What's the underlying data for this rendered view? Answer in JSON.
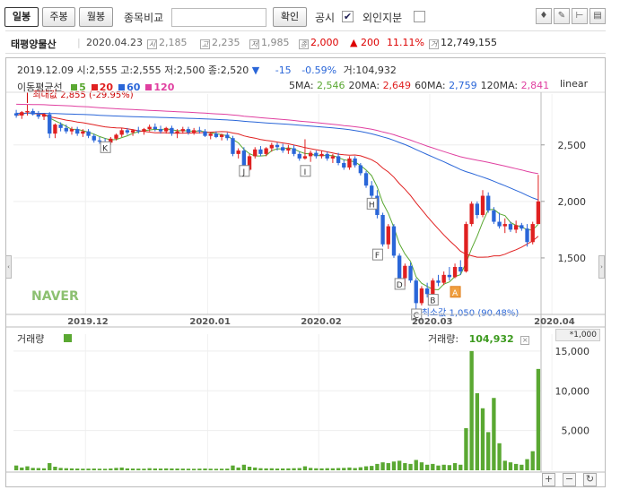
{
  "toolbar": {
    "tab_daily": "일봉",
    "tab_weekly": "주봉",
    "tab_monthly": "월봉",
    "compare_label": "종목비교",
    "compare_input_value": "",
    "confirm_label": "확인",
    "disclosure_label": "공시",
    "disclosure_checked": "✔",
    "foreign_label": "외인지분",
    "foreign_checked": ""
  },
  "info": {
    "name": "태평양물산",
    "date": "2020.04.23",
    "open": "2,185",
    "high": "2,235",
    "low": "1,985",
    "close": "2,000",
    "change": "▲ 200",
    "change_pct": "11.11%",
    "volume": "12,749,155",
    "icon_open": "시",
    "icon_high": "고",
    "icon_low": "저",
    "icon_close": "종",
    "icon_volume": "거"
  },
  "chart": {
    "header_line": "2019.12.09  시:2,555  고:2,555  저:2,500  종:2,520",
    "header_arrow": "▼",
    "header_change": "-15",
    "header_change_pct": "-0.59%",
    "header_volume": "거:104,932",
    "ma_title": "이동평균선",
    "ma_legend": [
      {
        "label": "5",
        "color": "#5aa832"
      },
      {
        "label": "20",
        "color": "#e02020"
      },
      {
        "label": "60",
        "color": "#2a66d8"
      },
      {
        "label": "120",
        "color": "#e040a0"
      }
    ],
    "ma_values": [
      {
        "label": "5MA:",
        "value": "2,546",
        "color": "#5aa832"
      },
      {
        "label": "20MA:",
        "value": "2,649",
        "color": "#e02020"
      },
      {
        "label": "60MA:",
        "value": "2,759",
        "color": "#2a66d8"
      },
      {
        "label": "120MA:",
        "value": "2,841",
        "color": "#e040a0"
      }
    ],
    "scale_label": "linear",
    "max_label": "최대값 2,855 (-29.95%)",
    "min_label": "최소값 1,050 (90.48%)",
    "watermark": "NAVER",
    "price_ticks": [
      "2,500",
      "2,000",
      "1,500"
    ],
    "date_ticks": [
      "2019.12",
      "2020.01",
      "2020.02",
      "2020.03",
      "2020.04"
    ],
    "markers": [
      "K",
      "J",
      "I",
      "H",
      "F",
      "D",
      "C",
      "B",
      "A"
    ],
    "volume_title": "거래량",
    "volume_label": "거래량:",
    "volume_value": "104,932",
    "volume_unit": "*1,000",
    "volume_ticks": [
      "15,000",
      "10,000",
      "5,000"
    ]
  },
  "chart_data": {
    "type": "candlestick",
    "title": "태평양물산",
    "x_ticks": [
      "2019.12",
      "2020.01",
      "2020.02",
      "2020.03",
      "2020.04"
    ],
    "y_ticks": [
      1500,
      2000,
      2500
    ],
    "ylim": [
      1000,
      2950
    ],
    "volume_ylim": [
      0,
      16000
    ],
    "volume_unit": "*1,000",
    "max_price": 2855,
    "min_price": 1050,
    "last_close": 2000,
    "candles": [
      {
        "o": 2780,
        "h": 2810,
        "l": 2740,
        "c": 2760,
        "v": 600
      },
      {
        "o": 2760,
        "h": 2800,
        "l": 2730,
        "c": 2790,
        "v": 350
      },
      {
        "o": 2790,
        "h": 2855,
        "l": 2760,
        "c": 2800,
        "v": 500
      },
      {
        "o": 2800,
        "h": 2820,
        "l": 2760,
        "c": 2770,
        "v": 300
      },
      {
        "o": 2770,
        "h": 2800,
        "l": 2730,
        "c": 2750,
        "v": 280
      },
      {
        "o": 2750,
        "h": 2780,
        "l": 2720,
        "c": 2770,
        "v": 250
      },
      {
        "o": 2770,
        "h": 2790,
        "l": 2560,
        "c": 2600,
        "v": 900
      },
      {
        "o": 2600,
        "h": 2690,
        "l": 2560,
        "c": 2680,
        "v": 450
      },
      {
        "o": 2680,
        "h": 2700,
        "l": 2620,
        "c": 2650,
        "v": 300
      },
      {
        "o": 2650,
        "h": 2680,
        "l": 2600,
        "c": 2620,
        "v": 260
      },
      {
        "o": 2620,
        "h": 2660,
        "l": 2590,
        "c": 2640,
        "v": 240
      },
      {
        "o": 2640,
        "h": 2660,
        "l": 2580,
        "c": 2600,
        "v": 220
      },
      {
        "o": 2600,
        "h": 2640,
        "l": 2570,
        "c": 2620,
        "v": 200
      },
      {
        "o": 2620,
        "h": 2640,
        "l": 2560,
        "c": 2580,
        "v": 210
      },
      {
        "o": 2580,
        "h": 2600,
        "l": 2520,
        "c": 2540,
        "v": 220
      },
      {
        "o": 2540,
        "h": 2570,
        "l": 2510,
        "c": 2530,
        "v": 200
      },
      {
        "o": 2530,
        "h": 2560,
        "l": 2500,
        "c": 2520,
        "v": 190
      },
      {
        "o": 2520,
        "h": 2570,
        "l": 2500,
        "c": 2555,
        "v": 230
      },
      {
        "o": 2555,
        "h": 2600,
        "l": 2540,
        "c": 2590,
        "v": 300
      },
      {
        "o": 2590,
        "h": 2650,
        "l": 2570,
        "c": 2630,
        "v": 350
      },
      {
        "o": 2630,
        "h": 2650,
        "l": 2590,
        "c": 2610,
        "v": 240
      },
      {
        "o": 2610,
        "h": 2640,
        "l": 2580,
        "c": 2630,
        "v": 220
      },
      {
        "o": 2630,
        "h": 2660,
        "l": 2600,
        "c": 2620,
        "v": 210
      },
      {
        "o": 2620,
        "h": 2650,
        "l": 2590,
        "c": 2640,
        "v": 200
      },
      {
        "o": 2640,
        "h": 2680,
        "l": 2620,
        "c": 2660,
        "v": 260
      },
      {
        "o": 2660,
        "h": 2690,
        "l": 2620,
        "c": 2640,
        "v": 230
      },
      {
        "o": 2640,
        "h": 2670,
        "l": 2600,
        "c": 2620,
        "v": 220
      },
      {
        "o": 2620,
        "h": 2660,
        "l": 2600,
        "c": 2650,
        "v": 240
      },
      {
        "o": 2650,
        "h": 2670,
        "l": 2580,
        "c": 2600,
        "v": 230
      },
      {
        "o": 2600,
        "h": 2640,
        "l": 2560,
        "c": 2620,
        "v": 220
      },
      {
        "o": 2620,
        "h": 2660,
        "l": 2600,
        "c": 2640,
        "v": 210
      },
      {
        "o": 2640,
        "h": 2660,
        "l": 2590,
        "c": 2610,
        "v": 200
      },
      {
        "o": 2610,
        "h": 2650,
        "l": 2590,
        "c": 2630,
        "v": 190
      },
      {
        "o": 2630,
        "h": 2660,
        "l": 2600,
        "c": 2620,
        "v": 210
      },
      {
        "o": 2620,
        "h": 2640,
        "l": 2570,
        "c": 2580,
        "v": 220
      },
      {
        "o": 2580,
        "h": 2610,
        "l": 2550,
        "c": 2600,
        "v": 200
      },
      {
        "o": 2600,
        "h": 2620,
        "l": 2560,
        "c": 2570,
        "v": 190
      },
      {
        "o": 2570,
        "h": 2600,
        "l": 2540,
        "c": 2590,
        "v": 200
      },
      {
        "o": 2590,
        "h": 2610,
        "l": 2540,
        "c": 2560,
        "v": 210
      },
      {
        "o": 2560,
        "h": 2580,
        "l": 2400,
        "c": 2420,
        "v": 600
      },
      {
        "o": 2420,
        "h": 2470,
        "l": 2380,
        "c": 2450,
        "v": 350
      },
      {
        "o": 2450,
        "h": 2480,
        "l": 2260,
        "c": 2280,
        "v": 700
      },
      {
        "o": 2280,
        "h": 2420,
        "l": 2270,
        "c": 2400,
        "v": 450
      },
      {
        "o": 2400,
        "h": 2480,
        "l": 2380,
        "c": 2460,
        "v": 350
      },
      {
        "o": 2460,
        "h": 2490,
        "l": 2400,
        "c": 2420,
        "v": 260
      },
      {
        "o": 2420,
        "h": 2480,
        "l": 2400,
        "c": 2470,
        "v": 240
      },
      {
        "o": 2470,
        "h": 2520,
        "l": 2440,
        "c": 2500,
        "v": 250
      },
      {
        "o": 2500,
        "h": 2520,
        "l": 2450,
        "c": 2480,
        "v": 220
      },
      {
        "o": 2480,
        "h": 2510,
        "l": 2430,
        "c": 2450,
        "v": 230
      },
      {
        "o": 2450,
        "h": 2500,
        "l": 2420,
        "c": 2470,
        "v": 240
      },
      {
        "o": 2470,
        "h": 2500,
        "l": 2400,
        "c": 2420,
        "v": 260
      },
      {
        "o": 2420,
        "h": 2440,
        "l": 2360,
        "c": 2380,
        "v": 280
      },
      {
        "o": 2380,
        "h": 2550,
        "l": 2370,
        "c": 2400,
        "v": 500
      },
      {
        "o": 2400,
        "h": 2450,
        "l": 2350,
        "c": 2430,
        "v": 300
      },
      {
        "o": 2430,
        "h": 2450,
        "l": 2380,
        "c": 2400,
        "v": 250
      },
      {
        "o": 2400,
        "h": 2450,
        "l": 2380,
        "c": 2420,
        "v": 240
      },
      {
        "o": 2420,
        "h": 2440,
        "l": 2360,
        "c": 2380,
        "v": 260
      },
      {
        "o": 2380,
        "h": 2420,
        "l": 2340,
        "c": 2400,
        "v": 250
      },
      {
        "o": 2400,
        "h": 2430,
        "l": 2320,
        "c": 2340,
        "v": 280
      },
      {
        "o": 2340,
        "h": 2370,
        "l": 2280,
        "c": 2300,
        "v": 300
      },
      {
        "o": 2300,
        "h": 2400,
        "l": 2280,
        "c": 2380,
        "v": 350
      },
      {
        "o": 2380,
        "h": 2400,
        "l": 2300,
        "c": 2320,
        "v": 280
      },
      {
        "o": 2320,
        "h": 2340,
        "l": 2230,
        "c": 2250,
        "v": 380
      },
      {
        "o": 2250,
        "h": 2270,
        "l": 2120,
        "c": 2140,
        "v": 500
      },
      {
        "o": 2140,
        "h": 2180,
        "l": 2030,
        "c": 2050,
        "v": 550
      },
      {
        "o": 2050,
        "h": 2100,
        "l": 1850,
        "c": 1880,
        "v": 800
      },
      {
        "o": 1880,
        "h": 1900,
        "l": 1600,
        "c": 1620,
        "v": 1000
      },
      {
        "o": 1620,
        "h": 1800,
        "l": 1580,
        "c": 1780,
        "v": 900
      },
      {
        "o": 1780,
        "h": 1800,
        "l": 1500,
        "c": 1520,
        "v": 1100
      },
      {
        "o": 1520,
        "h": 1540,
        "l": 1300,
        "c": 1320,
        "v": 1200
      },
      {
        "o": 1320,
        "h": 1450,
        "l": 1250,
        "c": 1430,
        "v": 900
      },
      {
        "o": 1430,
        "h": 1460,
        "l": 1280,
        "c": 1300,
        "v": 800
      },
      {
        "o": 1300,
        "h": 1320,
        "l": 1050,
        "c": 1100,
        "v": 1300
      },
      {
        "o": 1100,
        "h": 1250,
        "l": 1080,
        "c": 1230,
        "v": 1000
      },
      {
        "o": 1230,
        "h": 1280,
        "l": 1150,
        "c": 1180,
        "v": 700
      },
      {
        "o": 1180,
        "h": 1320,
        "l": 1170,
        "c": 1300,
        "v": 800
      },
      {
        "o": 1300,
        "h": 1350,
        "l": 1250,
        "c": 1280,
        "v": 600
      },
      {
        "o": 1280,
        "h": 1380,
        "l": 1260,
        "c": 1350,
        "v": 700
      },
      {
        "o": 1350,
        "h": 1420,
        "l": 1300,
        "c": 1330,
        "v": 650
      },
      {
        "o": 1330,
        "h": 1450,
        "l": 1320,
        "c": 1420,
        "v": 900
      },
      {
        "o": 1420,
        "h": 1480,
        "l": 1350,
        "c": 1380,
        "v": 700
      },
      {
        "o": 1380,
        "h": 1820,
        "l": 1370,
        "c": 1800,
        "v": 5300
      },
      {
        "o": 1800,
        "h": 2000,
        "l": 1780,
        "c": 1980,
        "v": 15000
      },
      {
        "o": 1980,
        "h": 2000,
        "l": 1850,
        "c": 1880,
        "v": 9700
      },
      {
        "o": 1880,
        "h": 2100,
        "l": 1860,
        "c": 2050,
        "v": 7800
      },
      {
        "o": 2050,
        "h": 2080,
        "l": 1900,
        "c": 1920,
        "v": 4800
      },
      {
        "o": 1920,
        "h": 1950,
        "l": 1800,
        "c": 1820,
        "v": 9100
      },
      {
        "o": 1820,
        "h": 1900,
        "l": 1760,
        "c": 1780,
        "v": 3400
      },
      {
        "o": 1780,
        "h": 1850,
        "l": 1720,
        "c": 1800,
        "v": 1200
      },
      {
        "o": 1800,
        "h": 1820,
        "l": 1730,
        "c": 1750,
        "v": 1000
      },
      {
        "o": 1750,
        "h": 1830,
        "l": 1720,
        "c": 1790,
        "v": 800
      },
      {
        "o": 1790,
        "h": 1810,
        "l": 1740,
        "c": 1760,
        "v": 700
      },
      {
        "o": 1760,
        "h": 1800,
        "l": 1600,
        "c": 1640,
        "v": 1400
      },
      {
        "o": 1640,
        "h": 1820,
        "l": 1620,
        "c": 1800,
        "v": 2400
      },
      {
        "o": 1800,
        "h": 2235,
        "l": 1985,
        "c": 2000,
        "v": 12749
      }
    ],
    "colors": {
      "up": "#e02020",
      "down": "#2a66d8",
      "volume": "#5aa832"
    }
  }
}
